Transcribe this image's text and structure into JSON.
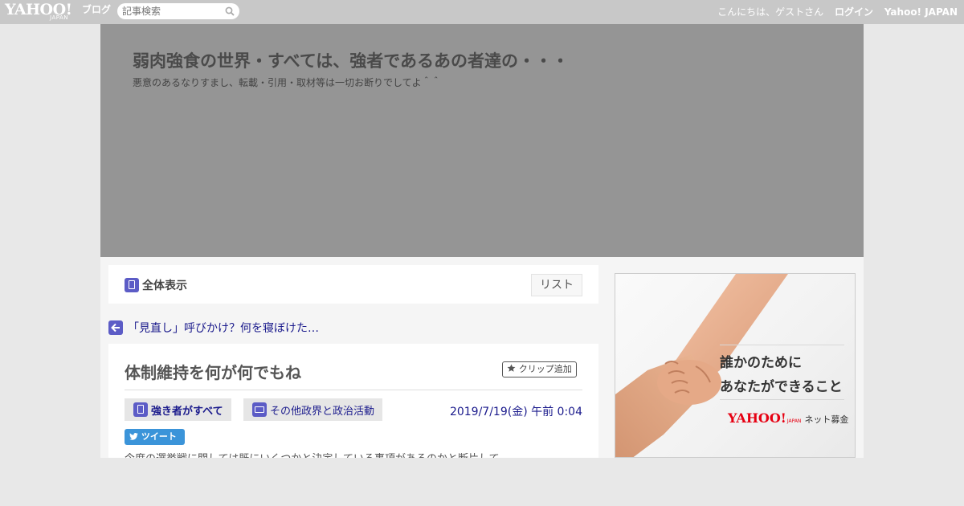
{
  "topbar": {
    "logo_main": "YAHOO!",
    "logo_sub": "JAPAN",
    "logo_blog": "ブログ",
    "search_placeholder": "記事検索",
    "greeting": "こんにちは、ゲストさん",
    "login": "ログイン",
    "yahoo_japan": "Yahoo! JAPAN"
  },
  "banner": {
    "title": "弱肉強食の世界・すべては、強者であるあの者達の・・・",
    "subtitle": "悪意のあるなりすまし、転載・引用・取材等は一切お断りでしてよ＾＾"
  },
  "viewbar": {
    "all_label": "全体表示",
    "list_label": "リスト"
  },
  "prev_article": {
    "label": "「見直し」呼びかけ？何を寝ぼけた…"
  },
  "article": {
    "title": "体制維持を何が何でもね",
    "clip_label": "クリップ追加",
    "theme": "強き者がすべて",
    "category": "その他政界と政治活動",
    "date": "2019/7/19(金) 午前 0:04",
    "tweet_label": "ツイート",
    "body_peek": "今度の選挙戦に関しては既にいくつかと決定している事項があるのかと断片して"
  },
  "ad": {
    "line1": "誰かのために",
    "line2": "あなたができること",
    "brand_main": "YAHOO!",
    "brand_sub": "JAPAN",
    "brand_service": "ネット募金"
  },
  "colors": {
    "accent": "#5c5cc6",
    "link": "#1a1a8c",
    "tweet": "#3b94d9",
    "topbar": "#c8c8c8",
    "banner": "#959595"
  }
}
